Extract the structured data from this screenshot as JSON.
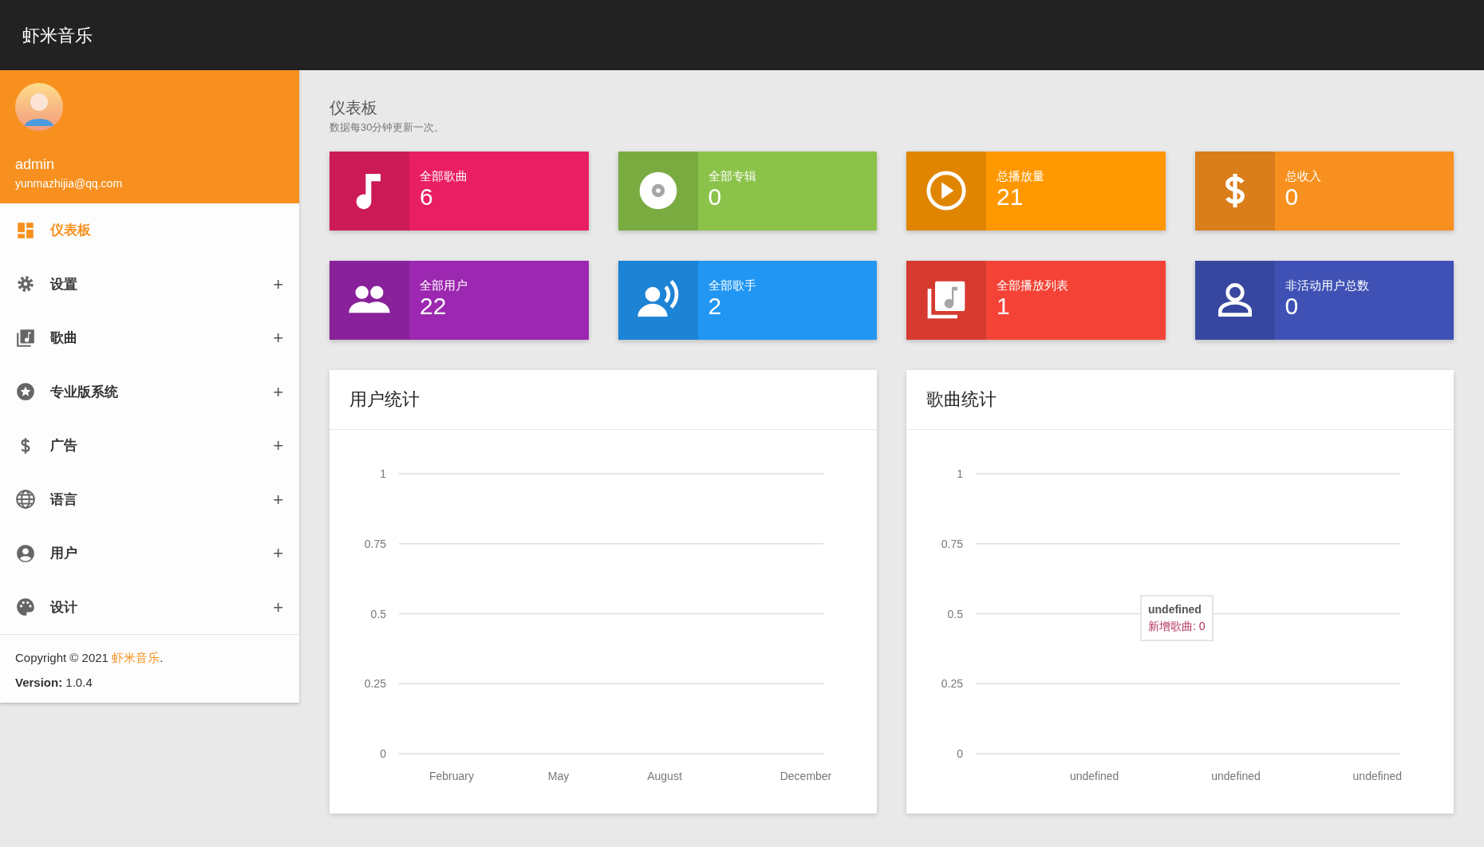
{
  "app": {
    "title": "虾米音乐"
  },
  "profile": {
    "name": "admin",
    "email": "yunmazhijia@qq.com"
  },
  "sidebar": {
    "items": [
      {
        "label": "仪表板",
        "kind": "dashboard",
        "selected": true
      },
      {
        "label": "设置",
        "kind": "gear",
        "selected": false,
        "toggle": "+"
      },
      {
        "label": "歌曲",
        "kind": "library",
        "selected": false,
        "toggle": "+"
      },
      {
        "label": "专业版系统",
        "kind": "star",
        "selected": false,
        "toggle": "+"
      },
      {
        "label": "广告",
        "kind": "dollar",
        "selected": false,
        "toggle": "+"
      },
      {
        "label": "语言",
        "kind": "globe",
        "selected": false,
        "toggle": "+"
      },
      {
        "label": "用户",
        "kind": "user",
        "selected": false,
        "toggle": "+"
      },
      {
        "label": "设计",
        "kind": "palette",
        "selected": false,
        "toggle": "+"
      }
    ],
    "footer": {
      "copyright": "Copyright © 2021 ",
      "brand": "虾米音乐",
      "after": ".",
      "version_label": "Version:",
      "version": "1.0.4"
    }
  },
  "header": {
    "title": "仪表板",
    "subtitle": "数据每30分钟更新一次。"
  },
  "stats": [
    {
      "label": "全部歌曲",
      "value": "6",
      "kind": "note",
      "color": "#e91e63"
    },
    {
      "label": "全部专辑",
      "value": "0",
      "kind": "disc",
      "color": "#8bc34a"
    },
    {
      "label": "总播放量",
      "value": "21",
      "kind": "play",
      "color": "#ff9800"
    },
    {
      "label": "总收入",
      "value": "0",
      "kind": "dollar",
      "color": "#f7901e"
    },
    {
      "label": "全部用户",
      "value": "22",
      "kind": "users",
      "color": "#9c27b0"
    },
    {
      "label": "全部歌手",
      "value": "2",
      "kind": "speaker",
      "color": "#2196f3"
    },
    {
      "label": "全部播放列表",
      "value": "1",
      "kind": "library",
      "color": "#f44336"
    },
    {
      "label": "非活动用户总数",
      "value": "0",
      "kind": "person",
      "color": "#3f51b5"
    }
  ],
  "charts": [
    {
      "title": "用户统计",
      "chart_data": {
        "type": "line",
        "grid": true,
        "categories": [
          "February",
          "May",
          "August",
          "December"
        ],
        "ylim": [
          0,
          1
        ],
        "yticks": [
          {
            "value": 0,
            "label": "0"
          },
          {
            "value": 0.25,
            "label": "0.25"
          },
          {
            "value": 0.5,
            "label": "0.5"
          },
          {
            "value": 0.75,
            "label": "0.75"
          },
          {
            "value": 1,
            "label": "1"
          }
        ]
      }
    },
    {
      "title": "歌曲统计",
      "chart_data": {
        "type": "line",
        "grid": true,
        "categories": [
          "undefined",
          "undefined",
          "undefined"
        ],
        "ylim": [
          0,
          1
        ],
        "yticks": [
          {
            "value": 0,
            "label": "0"
          },
          {
            "value": 0.25,
            "label": "0.25"
          },
          {
            "value": 0.5,
            "label": "0.5"
          },
          {
            "value": 0.75,
            "label": "0.75"
          },
          {
            "value": 1,
            "label": "1"
          }
        ]
      },
      "tooltip": {
        "title": "undefined",
        "text": "新增歌曲: 0"
      }
    }
  ]
}
